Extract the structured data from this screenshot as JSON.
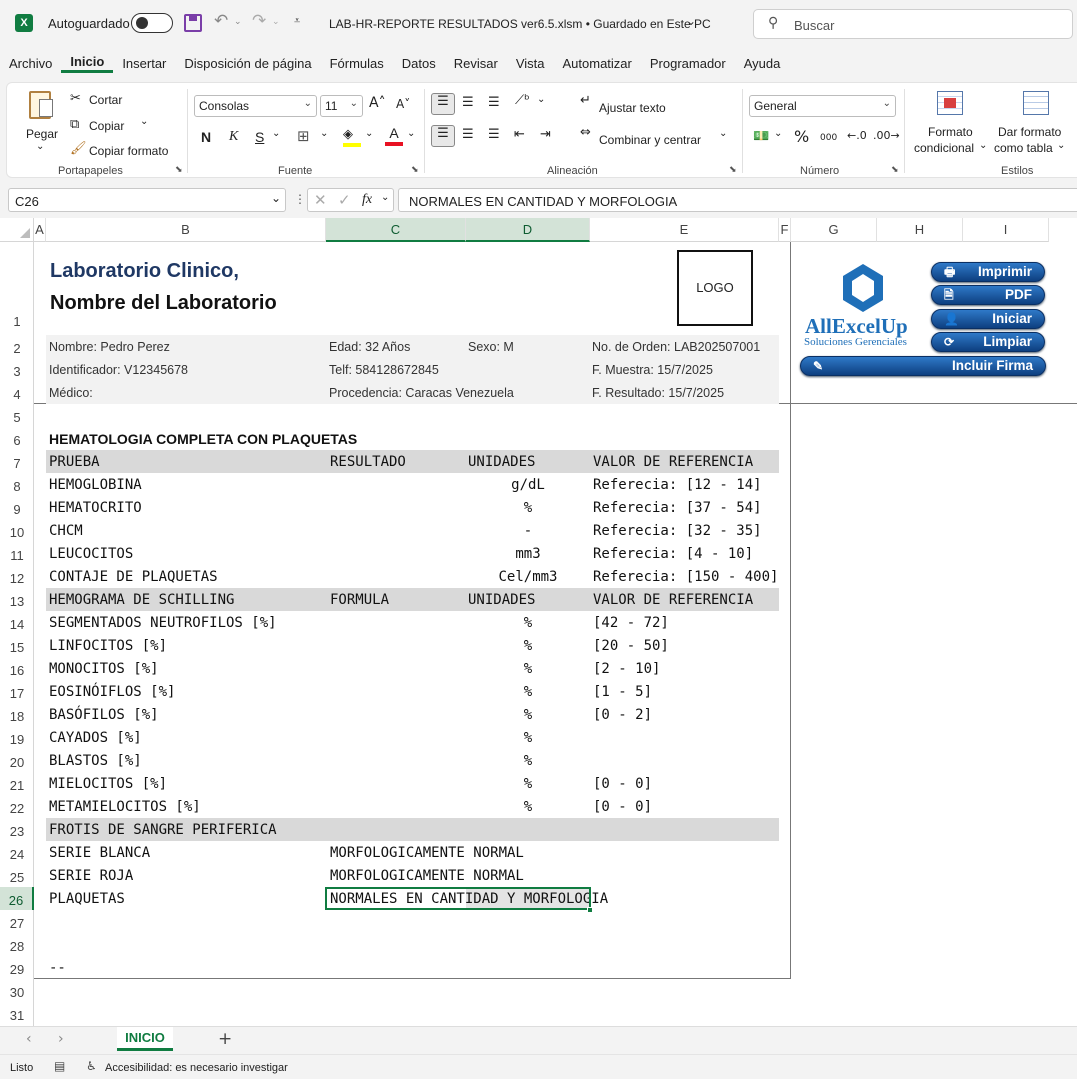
{
  "titlebar": {
    "autosave_label": "Autoguardado",
    "file_title": "LAB-HR-REPORTE RESULTADOS ver6.5.xlsm • Guardado en Este PC",
    "search_placeholder": "Buscar"
  },
  "menu": [
    "Archivo",
    "Inicio",
    "Insertar",
    "Disposición de página",
    "Fórmulas",
    "Datos",
    "Revisar",
    "Vista",
    "Automatizar",
    "Programador",
    "Ayuda"
  ],
  "ribbon": {
    "pegar": "Pegar",
    "cortar": "Cortar",
    "copiar": "Copiar",
    "copiar_formato": "Copiar formato",
    "grp_portapapeles": "Portapapeles",
    "font_name": "Consolas",
    "font_size": "11",
    "grp_fuente": "Fuente",
    "bold": "N",
    "italic": "K",
    "underline": "S",
    "ajustar_texto": "Ajustar texto",
    "combinar": "Combinar y centrar",
    "grp_alineacion": "Alineación",
    "number_format": "General",
    "grp_numero": "Número",
    "formato_condicional_1": "Formato",
    "formato_condicional_2": "condicional",
    "dar_formato_1": "Dar formato",
    "dar_formato_2": "como tabla",
    "grp_estilos": "Estilos",
    "percent": "%",
    "thousands": "000"
  },
  "formula": {
    "namebox": "C26",
    "fx": "fx",
    "content": "NORMALES EN CANTIDAD Y MORFOLOGIA"
  },
  "columns": [
    "A",
    "B",
    "C",
    "D",
    "E",
    "F",
    "G",
    "H",
    "I"
  ],
  "rows": [
    "1",
    "2",
    "3",
    "4",
    "5",
    "6",
    "7",
    "8",
    "9",
    "10",
    "11",
    "12",
    "13",
    "14",
    "15",
    "16",
    "17",
    "18",
    "19",
    "20",
    "21",
    "22",
    "23",
    "24",
    "25",
    "26",
    "27",
    "28",
    "29",
    "30",
    "31"
  ],
  "report": {
    "lab_name": "Laboratorio Clinico,",
    "lab_sub": "Nombre del Laboratorio",
    "logo": "LOGO",
    "nombre": "Nombre: Pedro Perez",
    "edad": "Edad: 32 Años",
    "sexo": "Sexo: M",
    "orden": "No. de Orden: LAB202507001",
    "identificador": "Identificador: V12345678",
    "telf": "Telf: 584128672845",
    "f_muestra": "F. Muestra: 15/7/2025",
    "medico": "Médico:",
    "procedencia": "Procedencia: Caracas Venezuela",
    "f_resultado": "F. Resultado: 15/7/2025",
    "section_title": "HEMATOLOGIA COMPLETA CON PLAQUETAS",
    "hdr1": {
      "b": "PRUEBA",
      "c": "RESULTADO",
      "d": "UNIDADES",
      "e": "VALOR DE REFERENCIA"
    },
    "rows1": [
      {
        "b": "HEMOGLOBINA",
        "d": "g/dL",
        "e": "Referecia: [12 - 14]"
      },
      {
        "b": "HEMATOCRITO",
        "d": "%",
        "e": "Referecia: [37 - 54]"
      },
      {
        "b": "CHCM",
        "d": "-",
        "e": "Referecia: [32 - 35]"
      },
      {
        "b": "LEUCOCITOS",
        "d": "mm3",
        "e": "Referecia: [4 - 10]"
      },
      {
        "b": "CONTAJE DE PLAQUETAS",
        "d": "Cel/mm3",
        "e": "Referecia: [150 - 400]"
      }
    ],
    "hdr2": {
      "b": "HEMOGRAMA DE SCHILLING",
      "c": "FORMULA",
      "d": "UNIDADES",
      "e": "VALOR DE REFERENCIA"
    },
    "rows2": [
      {
        "b": "SEGMENTADOS NEUTROFILOS [%]",
        "d": "%",
        "e": "[42 - 72]"
      },
      {
        "b": "LINFOCITOS [%]",
        "d": "%",
        "e": "[20 - 50]"
      },
      {
        "b": "MONOCITOS [%]",
        "d": "%",
        "e": "[2 - 10]"
      },
      {
        "b": "EOSINÓIFLOS [%]",
        "d": "%",
        "e": "[1 - 5]"
      },
      {
        "b": "BASÓFILOS [%]",
        "d": "%",
        "e": "[0 - 2]"
      },
      {
        "b": "CAYADOS [%]",
        "d": "%",
        "e": ""
      },
      {
        "b": "BLASTOS [%]",
        "d": "%",
        "e": ""
      },
      {
        "b": "MIELOCITOS [%]",
        "d": "%",
        "e": "[0 - 0]"
      },
      {
        "b": "METAMIELOCITOS [%]",
        "d": "%",
        "e": "[0 - 0]"
      }
    ],
    "hdr3": "FROTIS DE SANGRE PERIFERICA",
    "rows3": [
      {
        "b": "SERIE BLANCA",
        "c": "MORFOLOGICAMENTE NORMAL"
      },
      {
        "b": "SERIE ROJA",
        "c": "MORFOLOGICAMENTE NORMAL"
      },
      {
        "b": "PLAQUETAS",
        "c": "NORMALES EN CANTIDAD Y MORFOLOGIA"
      }
    ],
    "footer": "--"
  },
  "brand": {
    "name": "AllExcelUp",
    "tagline": "Soluciones Gerenciales",
    "color": "#1f6fb8"
  },
  "buttons": {
    "imprimir": "Imprimir",
    "pdf": "PDF",
    "iniciar": "Iniciar",
    "limpiar": "Limpiar",
    "firma": "Incluir Firma"
  },
  "sheet_tab": "INICIO",
  "status": {
    "ready": "Listo",
    "accessibility": "Accesibilidad: es necesario investigar"
  },
  "colors": {
    "excel_green": "#107c41",
    "header_gray": "#d9d9d9",
    "title_blue": "#1f3864",
    "button_blue": "#1a5aa3"
  }
}
